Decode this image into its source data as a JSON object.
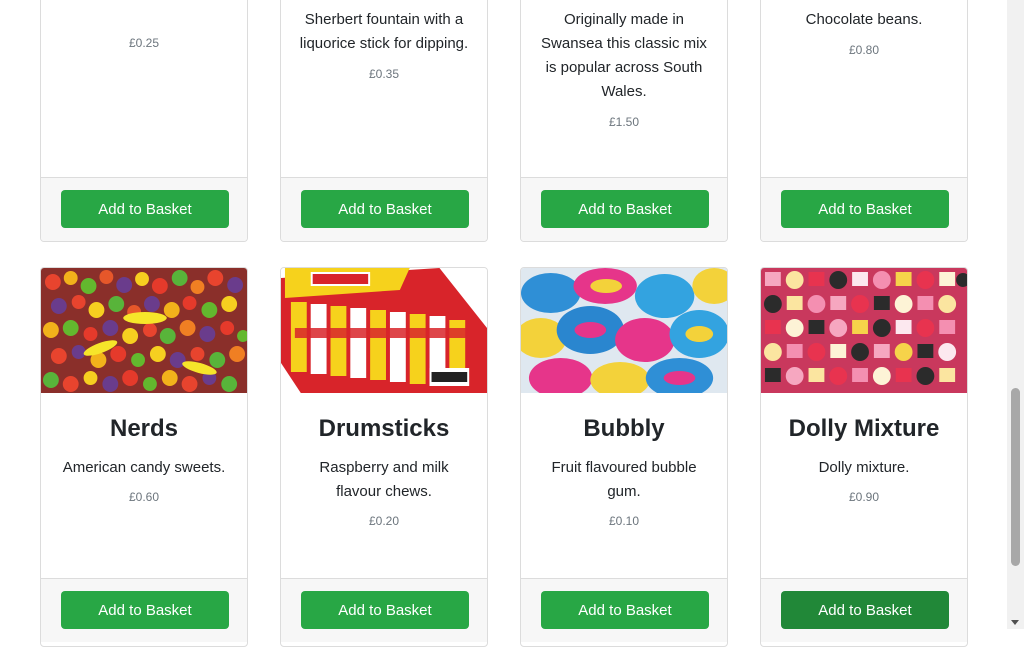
{
  "products_top": [
    {
      "description": "",
      "price": "£0.25",
      "button": "Add to Basket"
    },
    {
      "description": "Sherbert fountain with a liquorice stick for dipping.",
      "price": "£0.35",
      "button": "Add to Basket"
    },
    {
      "description": "Originally made in Swansea this classic mix is popular across South Wales.",
      "price": "£1.50",
      "button": "Add to Basket"
    },
    {
      "description": "Chocolate beans.",
      "price": "£0.80",
      "button": "Add to Basket"
    }
  ],
  "products_bottom": [
    {
      "title": "Nerds",
      "description": "American candy sweets.",
      "price": "£0.60",
      "button": "Add to Basket",
      "image": "nerds-candy-photo"
    },
    {
      "title": "Drumsticks",
      "description": "Raspberry and milk flavour chews.",
      "price": "£0.20",
      "button": "Add to Basket",
      "image": "drumstick-box-photo"
    },
    {
      "title": "Bubbly",
      "description": "Fruit flavoured bubble gum.",
      "price": "£0.10",
      "button": "Add to Basket",
      "image": "bubbly-gum-photo"
    },
    {
      "title": "Dolly Mixture",
      "description": "Dolly mixture.",
      "price": "£0.90",
      "button": "Add to Basket",
      "image": "dolly-mixture-photo"
    }
  ],
  "colors": {
    "button": "#28a745",
    "button_hover": "#218838",
    "price": "#6c757d"
  }
}
